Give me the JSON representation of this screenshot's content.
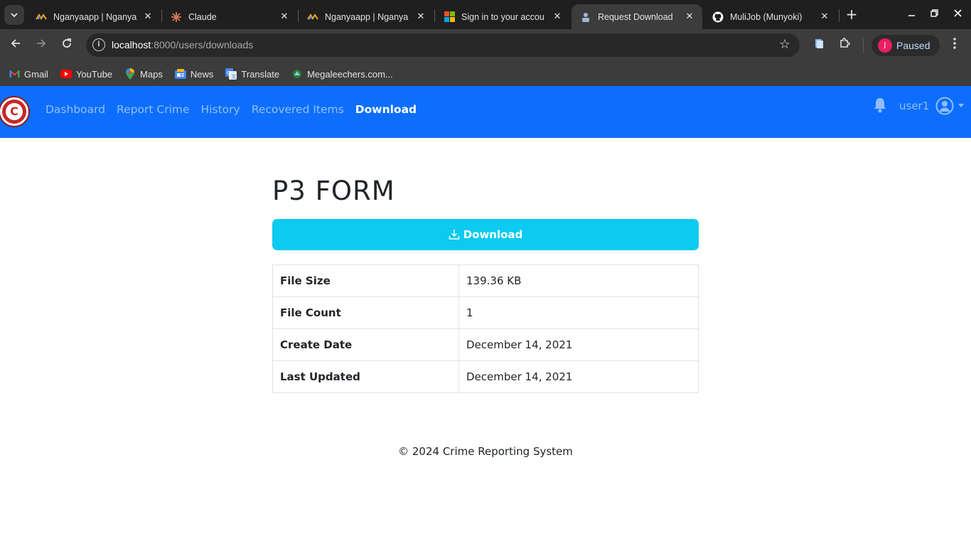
{
  "browser": {
    "tabs": [
      {
        "title": "Nganyaapp | Nganya",
        "favicon": "nganya-icon",
        "active": false
      },
      {
        "title": "Claude",
        "favicon": "claude-icon",
        "active": false
      },
      {
        "title": "Nganyaapp | Nganya",
        "favicon": "nganya-icon",
        "active": false
      },
      {
        "title": "Sign in to your accou",
        "favicon": "microsoft-icon",
        "active": false
      },
      {
        "title": "Request Download",
        "favicon": "page-icon",
        "active": true
      },
      {
        "title": "MuliJob (Munyoki)",
        "favicon": "github-icon",
        "active": false
      }
    ],
    "url_host": "localhost",
    "url_rest": ":8000/users/downloads",
    "profile_initial": "J",
    "profile_label": "Paused",
    "bookmarks": [
      {
        "label": "Gmail",
        "icon": "gmail-icon"
      },
      {
        "label": "YouTube",
        "icon": "youtube-icon"
      },
      {
        "label": "Maps",
        "icon": "maps-icon"
      },
      {
        "label": "News",
        "icon": "news-icon"
      },
      {
        "label": "Translate",
        "icon": "translate-icon"
      },
      {
        "label": "Megaleechers.com...",
        "icon": "megaleechers-icon"
      }
    ]
  },
  "navbar": {
    "links": [
      {
        "label": "Dashboard",
        "active": false
      },
      {
        "label": "Report Crime",
        "active": false
      },
      {
        "label": "History",
        "active": false
      },
      {
        "label": "Recovered Items",
        "active": false
      },
      {
        "label": "Download",
        "active": true
      }
    ],
    "username": "user1",
    "brand_color": "#0d6efd"
  },
  "main": {
    "title": "P3 FORM",
    "download_label": "Download",
    "download_color": "#0dcaf0",
    "details": [
      {
        "key": "File Size",
        "value": "139.36 KB"
      },
      {
        "key": "File Count",
        "value": "1"
      },
      {
        "key": "Create Date",
        "value": "December 14, 2021"
      },
      {
        "key": "Last Updated",
        "value": "December 14, 2021"
      }
    ]
  },
  "footer": {
    "text": "© 2024 Crime Reporting System"
  }
}
